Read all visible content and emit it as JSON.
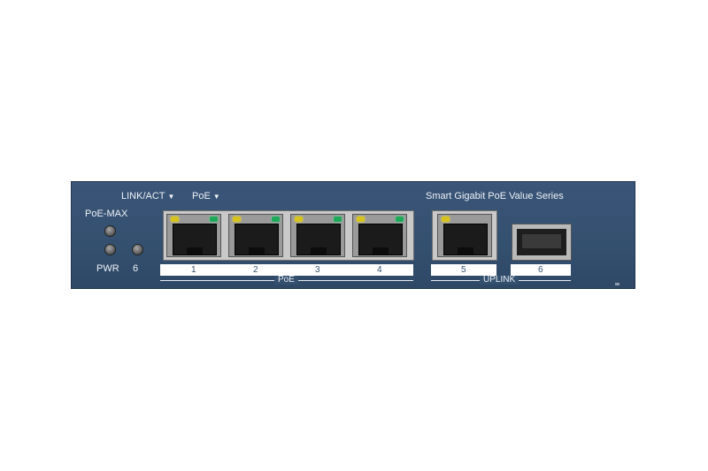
{
  "labels": {
    "link_act": "LINK/ACT",
    "poe_led": "PoE",
    "poe_max": "PoE-MAX",
    "pwr": "PWR",
    "sfp_led_num": "6",
    "series": "Smart Gigabit PoE Value Series"
  },
  "ports": {
    "poe_numbers": [
      "1",
      "2",
      "3",
      "4"
    ],
    "uplink_number": "5",
    "sfp_number": "6"
  },
  "groups": {
    "poe": "PoE",
    "uplink": "UPLINK"
  },
  "colors": {
    "chassis": "#34506f",
    "led_link": "#d6c31d",
    "led_poe": "#1ea85a"
  }
}
